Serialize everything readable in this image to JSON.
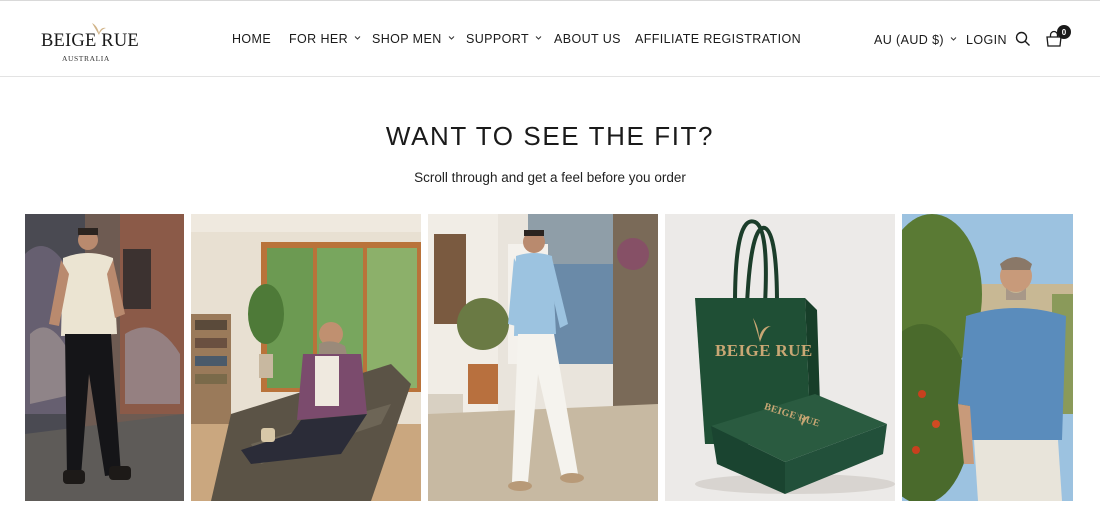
{
  "brand": {
    "name": "BEIGE RUE",
    "tagline": "AUSTRALIA"
  },
  "nav": [
    {
      "label": "HOME",
      "has_dropdown": false
    },
    {
      "label": "FOR HER",
      "has_dropdown": true
    },
    {
      "label": "SHOP MEN",
      "has_dropdown": true
    },
    {
      "label": "SUPPORT",
      "has_dropdown": true
    },
    {
      "label": "ABOUT US",
      "has_dropdown": false
    },
    {
      "label": "AFFILIATE REGISTRATION",
      "has_dropdown": false
    }
  ],
  "tools": {
    "currency": "AU (AUD $)",
    "login": "LOGIN",
    "search_icon": "search-icon",
    "cart_icon": "shopping-bag-icon",
    "cart_count": "0"
  },
  "section": {
    "title": "WANT TO SEE THE FIT?",
    "subtitle": "Scroll through and get a feel before you order"
  },
  "gallery": [
    {
      "subject": "man in cream shirt by graffiti wall"
    },
    {
      "subject": "man relaxing on leather sofa with mug"
    },
    {
      "subject": "man in light blue linen shirt walking"
    },
    {
      "subject": "green branded shopping bag and box"
    },
    {
      "subject": "man in blue knit tee in garden"
    }
  ],
  "packaging_text": {
    "bag": "BEIGE RUE",
    "box": "BEIGE RUE"
  },
  "colors": {
    "text": "#1a1a1a",
    "brand_green": "#1f4f35",
    "accent_gold": "#c9a774"
  }
}
